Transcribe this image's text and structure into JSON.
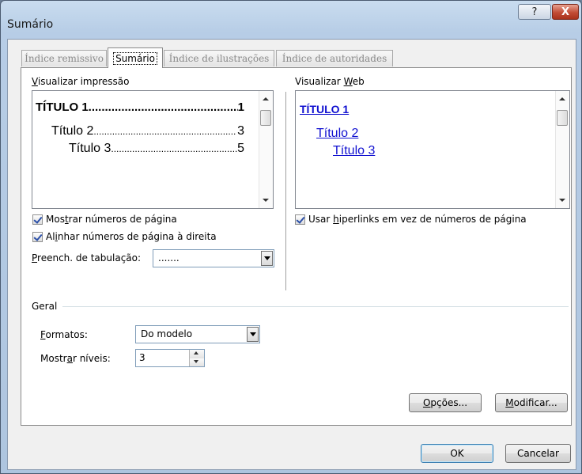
{
  "window": {
    "title": "Sumário",
    "help_glyph": "?",
    "close_glyph": "X"
  },
  "tabs": [
    {
      "label": "Índice remissivo"
    },
    {
      "label": "Sumário"
    },
    {
      "label": "Índice de ilustrações"
    },
    {
      "label": "Índice de autoridades"
    }
  ],
  "print_preview": {
    "label_prefix": "",
    "label_accel": "V",
    "label_rest": "isualizar impressão",
    "lines": [
      {
        "text": "TÍTULO 1",
        "dots": "...............................................",
        "page": "1"
      },
      {
        "text": "Título 2",
        "dots": "......................................................",
        "page": "3"
      },
      {
        "text": "Título 3",
        "dots": "......................................................",
        "page": "5"
      }
    ]
  },
  "web_preview": {
    "label_prefix": "Visualizar ",
    "label_accel": "W",
    "label_rest": "eb",
    "links": [
      "TÍTULO 1",
      "Título 2",
      "Título 3"
    ]
  },
  "options": {
    "show_page_numbers": {
      "pre": "Mos",
      "accel": "t",
      "post": "rar números de página",
      "checked": true
    },
    "align_right": {
      "pre": "Al",
      "accel": "i",
      "post": "nhar números de página à direita",
      "checked": true
    },
    "use_hyperlinks": {
      "pre": "Usar ",
      "accel": "h",
      "post": "iperlinks em vez de números de página",
      "checked": true
    },
    "tab_leader": {
      "pre": "",
      "accel": "P",
      "post": "reench. de tabulação:",
      "value": "......."
    }
  },
  "general": {
    "heading": "Geral",
    "formats": {
      "pre": "",
      "accel": "F",
      "post": "ormatos:",
      "value": "Do modelo"
    },
    "levels": {
      "pre": "Mostr",
      "accel": "a",
      "post": "r níveis:",
      "value": "3"
    }
  },
  "buttons": {
    "options": {
      "pre": "",
      "accel": "O",
      "post": "pções..."
    },
    "modify": {
      "pre": "",
      "accel": "M",
      "post": "odificar..."
    },
    "ok": "OK",
    "cancel": "Cancelar"
  }
}
